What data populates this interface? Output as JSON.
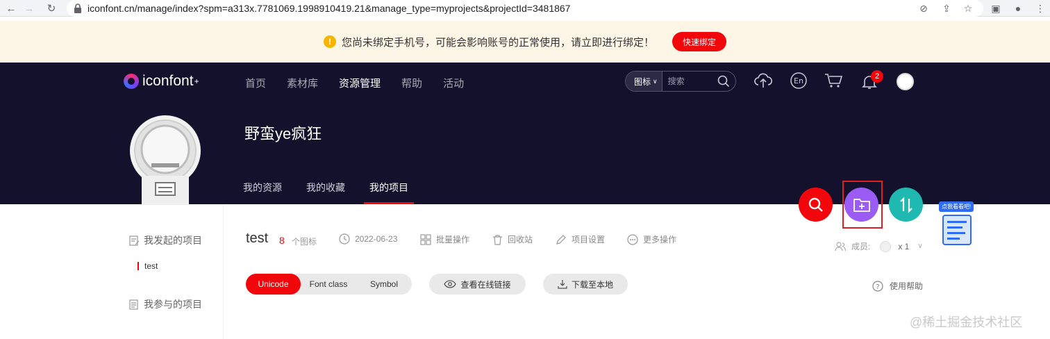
{
  "browser": {
    "url": "iconfont.cn/manage/index?spm=a313x.7781069.1998910419.21&manage_type=myprojects&projectId=3481867"
  },
  "notice": {
    "text": "您尚未绑定手机号，可能会影响账号的正常使用，请立即进行绑定！",
    "button": "快速绑定"
  },
  "header": {
    "logo": "iconfont",
    "nav": [
      "首页",
      "素材库",
      "资源管理",
      "帮助",
      "活动"
    ],
    "search": {
      "type": "图标",
      "placeholder": "搜索"
    },
    "notification_count": "2",
    "lang_label": "En"
  },
  "profile": {
    "name": "野蛮ye疯狂",
    "tabs": [
      "我的资源",
      "我的收藏",
      "我的项目"
    ]
  },
  "sidebar": {
    "items": [
      "我发起的项目",
      "我参与的项目"
    ],
    "active_project": "test"
  },
  "project": {
    "name": "test",
    "icon_count": "8",
    "icon_unit": "个图标",
    "date": "2022-06-23",
    "actions": [
      "批量操作",
      "回收站",
      "项目设置",
      "更多操作"
    ],
    "formats": [
      "Unicode",
      "Font class",
      "Symbol"
    ],
    "view_link": "查看在线链接",
    "download": "下载至本地",
    "members_label": "成员:",
    "members_count": "x 1",
    "usage_help": "使用帮助"
  },
  "help_widget": {
    "tag": "点我看看吧!"
  },
  "watermark": "@稀土掘金技术社区",
  "colors": {
    "brand_red": "#f0060b",
    "header_bg": "#13112b",
    "fab_search": "#f0060b",
    "fab_folder": "#9a5cf5",
    "fab_sort": "#1fb9b2",
    "highlight_box": "#e02020"
  }
}
